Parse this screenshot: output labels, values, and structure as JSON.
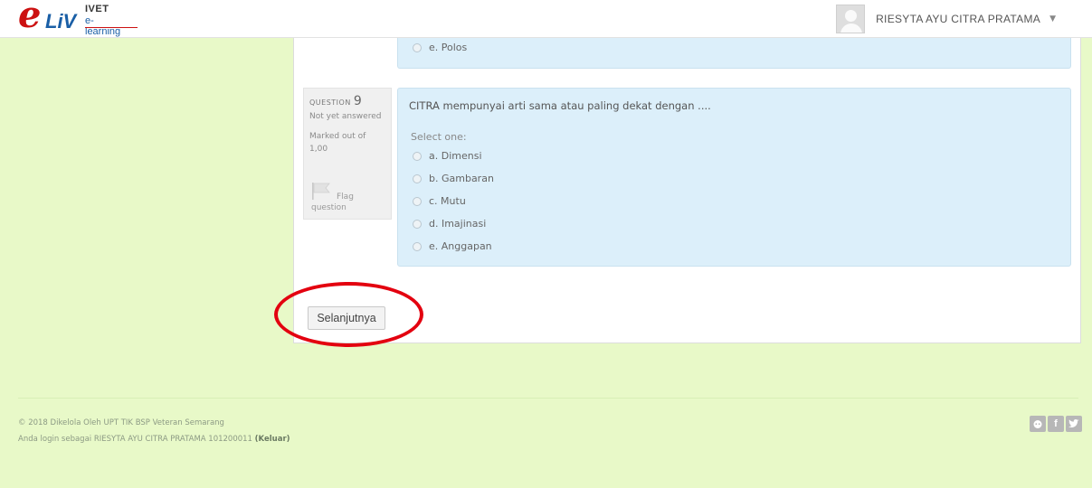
{
  "header": {
    "logo_e": "e",
    "logo_liv": "LiV",
    "logo_ivet": "IVET",
    "logo_elearning": "e-learning",
    "user_name": "RIESYTA AYU CITRA PRATAMA",
    "caret": "▼"
  },
  "prev_question": {
    "option_e": "e. Polos"
  },
  "question": {
    "label": "QUESTION",
    "number": "9",
    "status": "Not yet answered",
    "marked_out_of": "Marked out of",
    "mark_value": "1,00",
    "flag_label_line1": "Flag",
    "flag_label_line2": "question",
    "text": "CITRA mempunyai arti sama atau paling dekat dengan ....",
    "select_one": "Select one:",
    "options": [
      "a. Dimensi",
      "b. Gambaran",
      "c. Mutu",
      "d. Imajinasi",
      "e. Anggapan"
    ]
  },
  "navigation": {
    "next_button": "Selanjutnya"
  },
  "footer": {
    "copyright": "© 2018 Dikelola Oleh UPT TIK BSP Veteran Semarang",
    "login_text": "Anda login sebagai RIESYTA AYU CITRA PRATAMA 101200011",
    "logout": "(Keluar)",
    "social": [
      "reddit-icon",
      "facebook-icon",
      "twitter-icon"
    ]
  },
  "colors": {
    "page_bg": "#e8f9c8",
    "card_bg": "#dceffa",
    "highlight_circle": "#e3000f",
    "logo_red": "#cc1111",
    "logo_blue": "#1a5fa6"
  }
}
